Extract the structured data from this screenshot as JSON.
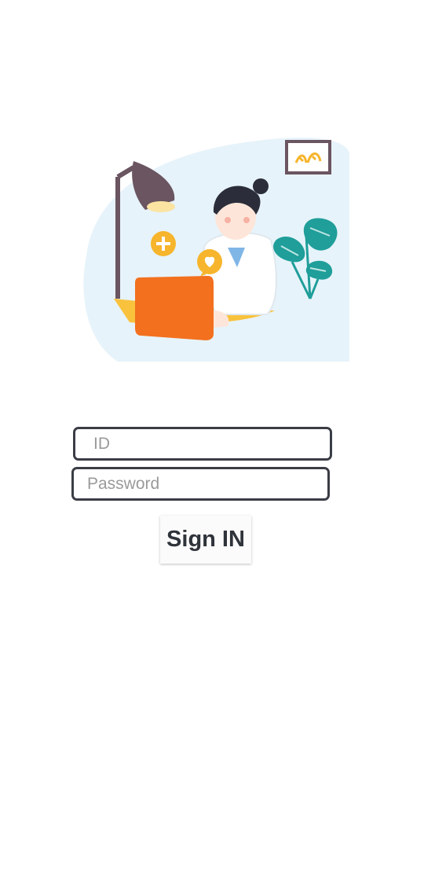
{
  "illustration": {
    "description_icon": "doctor-laptop-illustration-icon"
  },
  "form": {
    "id_placeholder": "ID",
    "id_value": "",
    "password_placeholder": "Password",
    "password_value": ""
  },
  "signin": {
    "label": "Sign IN"
  },
  "colors": {
    "field_border": "#3a3d45",
    "button_text": "#2f333a",
    "laptop": "#f3701e",
    "plant": "#1f9e9a",
    "accent_yellow": "#f6b52c",
    "lamp": "#6a5560"
  }
}
